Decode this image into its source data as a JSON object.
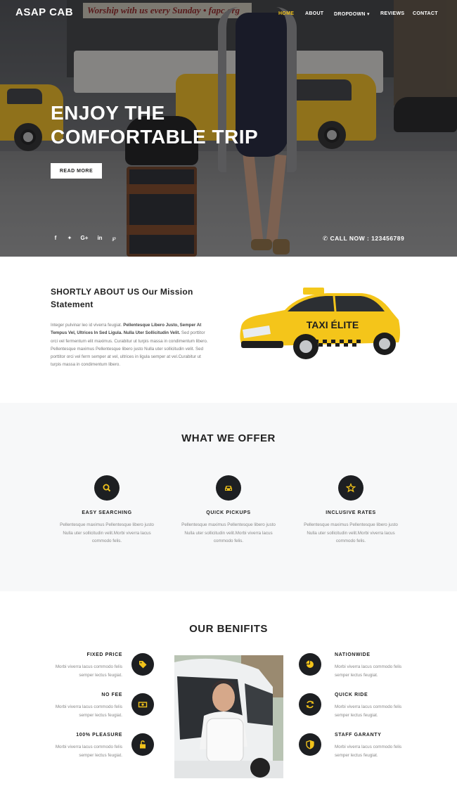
{
  "brand": "ASAP CAB",
  "nav": [
    {
      "label": "HOME",
      "active": true
    },
    {
      "label": "ABOUT",
      "active": false
    },
    {
      "label": "DROPDOWN ▾",
      "active": false
    },
    {
      "label": "REVIEWS",
      "active": false
    },
    {
      "label": "CONTACT",
      "active": false
    }
  ],
  "hero": {
    "banner_text": "Worship with us every Sunday • fapc.org",
    "title_line1": "ENJOY THE",
    "title_line2": "COMFORTABLE TRIP",
    "button": "READ MORE",
    "socials": [
      "f",
      "✦",
      "G+",
      "in",
      "℘"
    ],
    "call": "✆ CALL NOW : 123456789"
  },
  "about": {
    "title": "SHORTLY ABOUT US Our Mission Statement",
    "text_plain1": "Integer pulvinar leo id viverra feugiat. ",
    "text_bold": "Pellentesque Libero Justo, Semper At Tempus Vel, Ultrices In Sed Ligula. Nulla Uter Sollicitudin Velit.",
    "text_plain2": " Sed porttitor orci vel fermentum elit maximus. Curabitur ut turpis massa in condimentum libero. Pellentesque maximus Pellentesque libero justo Nulla uter sollicitudin velit. Sed porttitor orci vel ferm semper at vel, ultrices in ligula semper at vel.Curabitur ut turpis massa in condimentum libero.",
    "taxi_sign": "TAXI ÉLITE"
  },
  "offer": {
    "title": "WHAT WE OFFER",
    "items": [
      {
        "icon": "search-icon",
        "heading": "EASY SEARCHING",
        "text": "Pellentesque maximus Pellentesque libero justo Nulla uter sollicitudin velit.Morbi viverra lacus commodo felis."
      },
      {
        "icon": "car-icon",
        "heading": "QUICK PICKUPS",
        "text": "Pellentesque maximus Pellentesque libero justo Nulla uter sollicitudin velit.Morbi viverra lacus commodo felis."
      },
      {
        "icon": "star-icon",
        "heading": "INCLUSIVE RATES",
        "text": "Pellentesque maximus Pellentesque libero justo Nulla uter sollicitudin velit.Morbi viverra lacus commodo felis."
      }
    ]
  },
  "benefits": {
    "title": "OUR BENIFITS",
    "left": [
      {
        "icon": "tag-icon",
        "heading": "FIXED PRICE",
        "text": "Morbi viverra lacus commodo felis semper lectus feugiat."
      },
      {
        "icon": "money-icon",
        "heading": "NO FEE",
        "text": "Morbi viverra lacus commodo felis semper lectus feugiat."
      },
      {
        "icon": "unlock-icon",
        "heading": "100% PLEASURE",
        "text": "Morbi viverra lacus commodo felis semper lectus feugiat."
      }
    ],
    "right": [
      {
        "icon": "pie-chart-icon",
        "heading": "NATIONWIDE",
        "text": "Morbi viverra lacus commodo felis semper lectus feugiat."
      },
      {
        "icon": "refresh-icon",
        "heading": "QUICK RIDE",
        "text": "Morbi viverra lacus commodo felis semper lectus feugiat."
      },
      {
        "icon": "shield-icon",
        "heading": "STAFF GARANTY",
        "text": "Morbi viverra lacus commodo felis semper lectus feugiat."
      }
    ]
  },
  "colors": {
    "accent": "#f2c31b",
    "dark": "#1d1f22",
    "offer_bg": "#f7f8f9"
  }
}
